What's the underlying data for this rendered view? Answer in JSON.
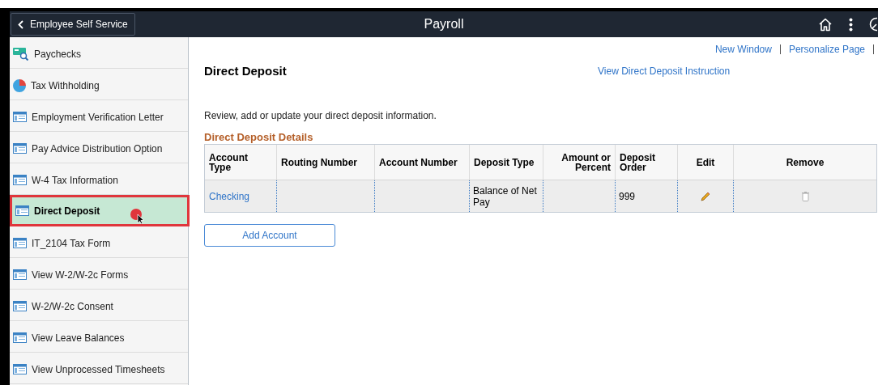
{
  "header": {
    "back_label": "Employee Self Service",
    "title": "Payroll"
  },
  "sidebar": {
    "items": [
      {
        "label": "Paychecks",
        "kind": "paychecks",
        "selected": false
      },
      {
        "label": "Tax Withholding",
        "kind": "pie",
        "selected": false
      },
      {
        "label": "Employment Verification Letter",
        "kind": "page",
        "selected": false
      },
      {
        "label": "Pay Advice Distribution Option",
        "kind": "page",
        "selected": false
      },
      {
        "label": "W-4 Tax Information",
        "kind": "page",
        "selected": false
      },
      {
        "label": "Direct Deposit",
        "kind": "page",
        "selected": true
      },
      {
        "label": "IT_2104 Tax Form",
        "kind": "page",
        "selected": false
      },
      {
        "label": "View W-2/W-2c Forms",
        "kind": "page",
        "selected": false
      },
      {
        "label": "W-2/W-2c Consent",
        "kind": "page",
        "selected": false
      },
      {
        "label": "View Leave Balances",
        "kind": "page",
        "selected": false
      },
      {
        "label": "View Unprocessed Timesheets",
        "kind": "page",
        "selected": false
      }
    ]
  },
  "page_links": [
    "New Window",
    "Personalize Page"
  ],
  "page_title": "Direct Deposit",
  "instruction_link": "View Direct Deposit Instruction",
  "intro": "Review, add or update your direct deposit information.",
  "section_title": "Direct Deposit Details",
  "table": {
    "columns": [
      "Account Type",
      "Routing Number",
      "Account Number",
      "Deposit Type",
      "Amount or Percent",
      "Deposit Order",
      "Edit",
      "Remove"
    ],
    "rows": [
      {
        "account_type": "Checking",
        "routing_number": "",
        "account_number": "",
        "deposit_type": "Balance of Net Pay",
        "amount": "",
        "deposit_order": "999"
      }
    ]
  },
  "add_button": "Add Account"
}
